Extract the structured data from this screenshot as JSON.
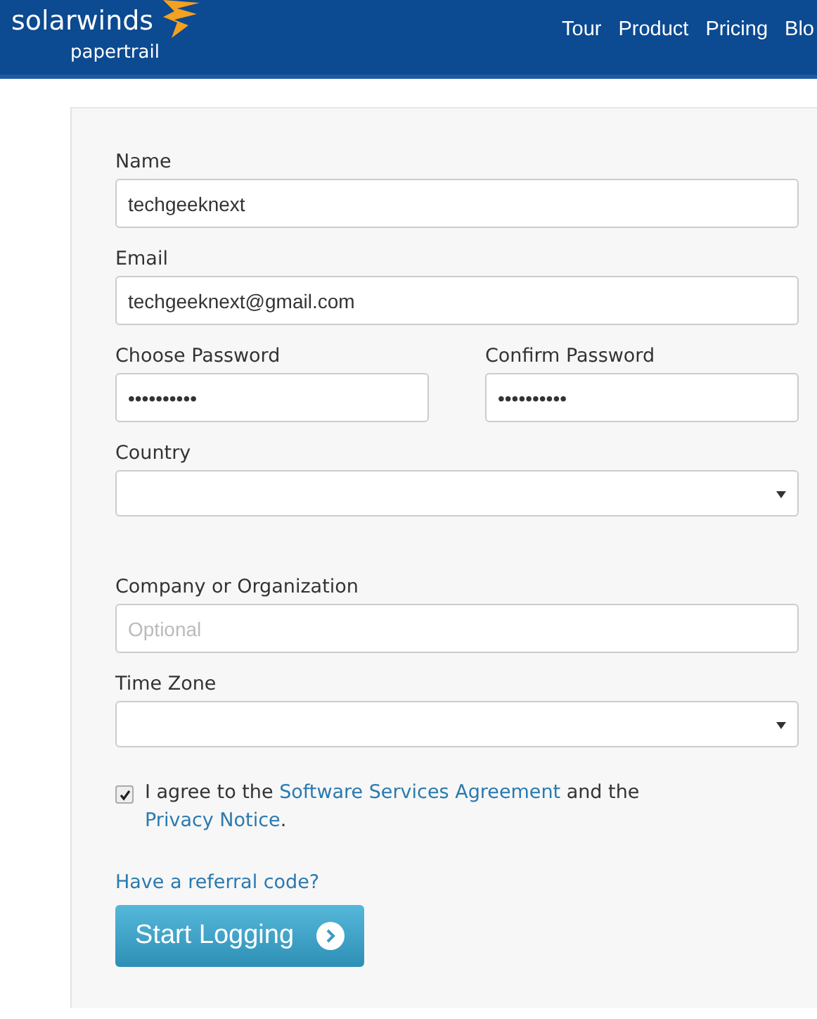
{
  "header": {
    "brand": "solarwinds",
    "product": "papertrail",
    "nav": [
      {
        "label": "Tour"
      },
      {
        "label": "Product"
      },
      {
        "label": "Pricing"
      },
      {
        "label": "Blo"
      }
    ]
  },
  "form": {
    "rows": [
      {
        "fields": [
          {
            "kind": "text",
            "label": "Name",
            "value": "techgeeknext"
          }
        ]
      },
      {
        "fields": [
          {
            "kind": "text",
            "label": "Email",
            "value": "techgeeknext@gmail.com"
          }
        ]
      },
      {
        "fields": [
          {
            "kind": "text",
            "label": "Choose Password",
            "value": "••••••••••"
          },
          {
            "kind": "text",
            "label": "Confirm Password",
            "value": "••••••••••"
          }
        ]
      },
      {
        "fields": [
          {
            "kind": "select",
            "label": "Country"
          }
        ]
      },
      {
        "fields": [
          {
            "kind": "text",
            "label": "Company or Organization",
            "placeholder": "Optional"
          }
        ]
      },
      {
        "fields": [
          {
            "kind": "select",
            "label": "Time Zone"
          }
        ]
      }
    ],
    "agreement": {
      "checked": true,
      "parts": [
        {
          "text": "I agree to the ",
          "link": false
        },
        {
          "text": "Software Services Agreement",
          "link": true
        },
        {
          "text": " and the ",
          "link": false
        },
        {
          "text": "Privacy Notice",
          "link": true
        },
        {
          "text": ".",
          "link": false
        }
      ]
    },
    "referral": "Have a referral code?",
    "submit": "Start Logging"
  }
}
